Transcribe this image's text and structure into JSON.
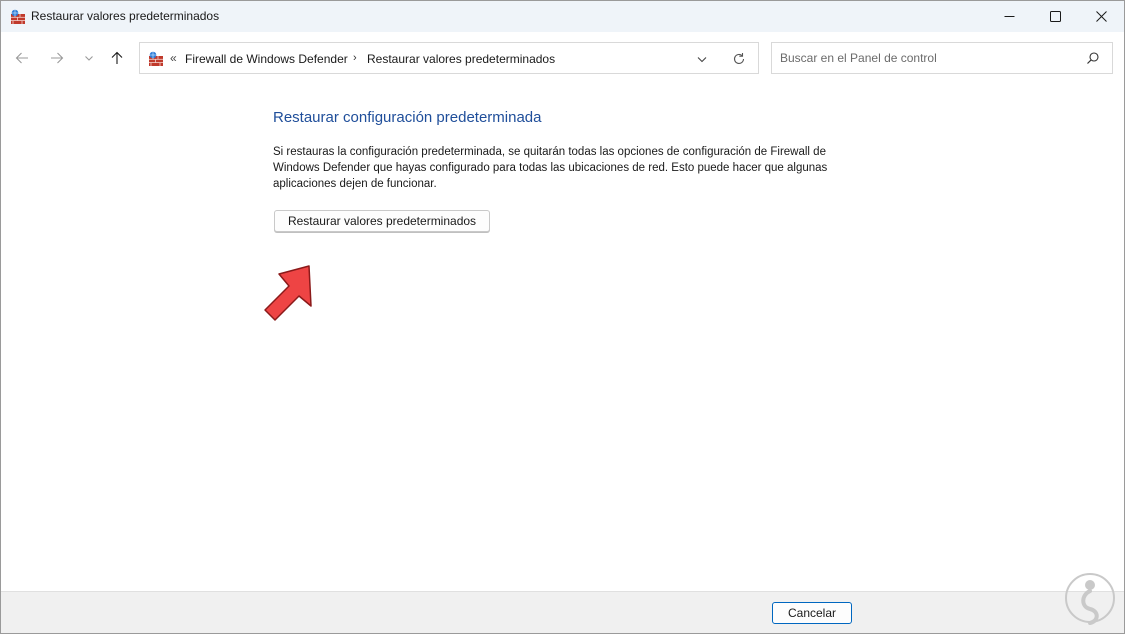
{
  "window": {
    "title": "Restaurar valores predeterminados"
  },
  "address_bar": {
    "overflow": "«",
    "breadcrumbs": [
      "Firewall de Windows Defender",
      "Restaurar valores predeterminados"
    ],
    "separator": "›"
  },
  "search": {
    "placeholder": "Buscar en el Panel de control",
    "value": ""
  },
  "main": {
    "heading": "Restaurar configuración predeterminada",
    "description": "Si restauras la configuración predeterminada, se quitarán todas las opciones de configuración de Firewall de Windows Defender que hayas configurado para todas las ubicaciones de red. Esto puede hacer que algunas aplicaciones dejen de funcionar.",
    "restore_button": "Restaurar valores predeterminados"
  },
  "footer": {
    "cancel_button": "Cancelar"
  },
  "colors": {
    "heading": "#1f4e9a",
    "titlebar": "#eff4f9",
    "footer": "#f0f0f0",
    "annotation_arrow": "#ee4444",
    "focus_border": "#0067c0"
  },
  "icons": {
    "app": "firewall-icon",
    "nav": [
      "back-arrow-icon",
      "forward-arrow-icon",
      "chevron-down-icon",
      "up-arrow-icon"
    ],
    "address": [
      "firewall-icon",
      "chevron-down-icon",
      "refresh-icon"
    ],
    "search": "search-icon",
    "window_controls": [
      "minimize-icon",
      "maximize-icon",
      "close-icon"
    ]
  }
}
